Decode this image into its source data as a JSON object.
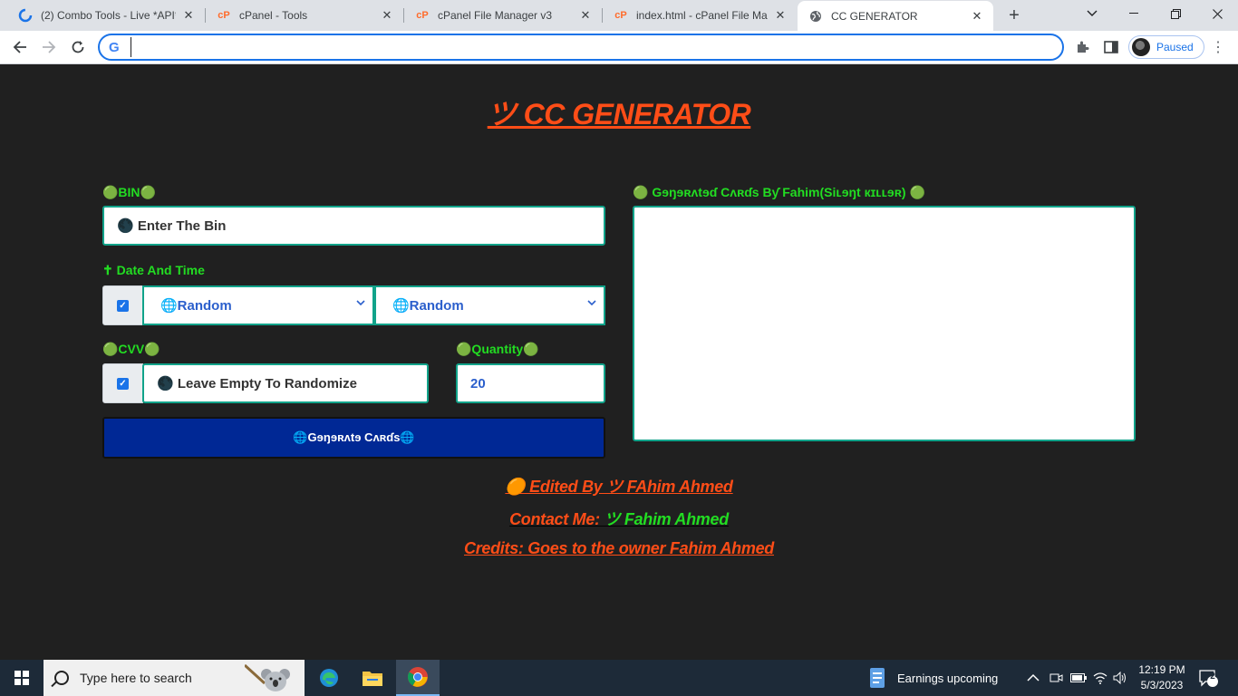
{
  "browser": {
    "tabs": [
      {
        "title": "(2) Combo Tools - Live *API*",
        "icon": "combo-tools-favicon"
      },
      {
        "title": "cPanel - Tools",
        "icon": "cpanel-favicon"
      },
      {
        "title": "cPanel File Manager v3",
        "icon": "cpanel-favicon"
      },
      {
        "title": "index.html - cPanel File Mana",
        "icon": "cpanel-favicon"
      },
      {
        "title": "CC GENERATOR",
        "icon": "globe-favicon",
        "active": true
      }
    ],
    "address": "",
    "profile_label": "Paused"
  },
  "page": {
    "title": "ツ CC GENERATOR",
    "bin_label": "🟢BIN🟢",
    "bin_placeholder": "🌑 Enter The Bin",
    "date_label": "✝ Date And Time",
    "month_select": "🌐Random",
    "year_select": "🌐Random",
    "cvv_label": "🟢CVV🟢",
    "cvv_placeholder": "🌑 Leave Empty To Randomize",
    "quantity_label": "🟢Quantity🟢",
    "quantity_value": "20",
    "generate_button": "🌐Gɘŋɘʀʌtɘ Cʌʀɗs🌐",
    "output_label": "🟢 Gɘŋɘʀʌtɘɗ Cʌʀɗs Bƴ Fahim(Siʟɘŋt кɪʟʟɘʀ) 🟢",
    "output_value": "",
    "edited_by": "🟠 Edited By ツ FAhim Ahmed",
    "contact_prefix": "Contact Me: ",
    "contact_name": "ツ Fahim Ahmed",
    "credits": "Credits: Goes to the owner Fahim Ahmed"
  },
  "taskbar": {
    "search_placeholder": "Type here to search",
    "weather_text": "Earnings upcoming",
    "time": "12:19 PM",
    "date": "5/3/2023",
    "notification_count": "2"
  },
  "colors": {
    "title_accent": "#ff4d17",
    "label_green": "#22dd22",
    "button_blue": "#002895",
    "field_border": "#11a38a"
  }
}
